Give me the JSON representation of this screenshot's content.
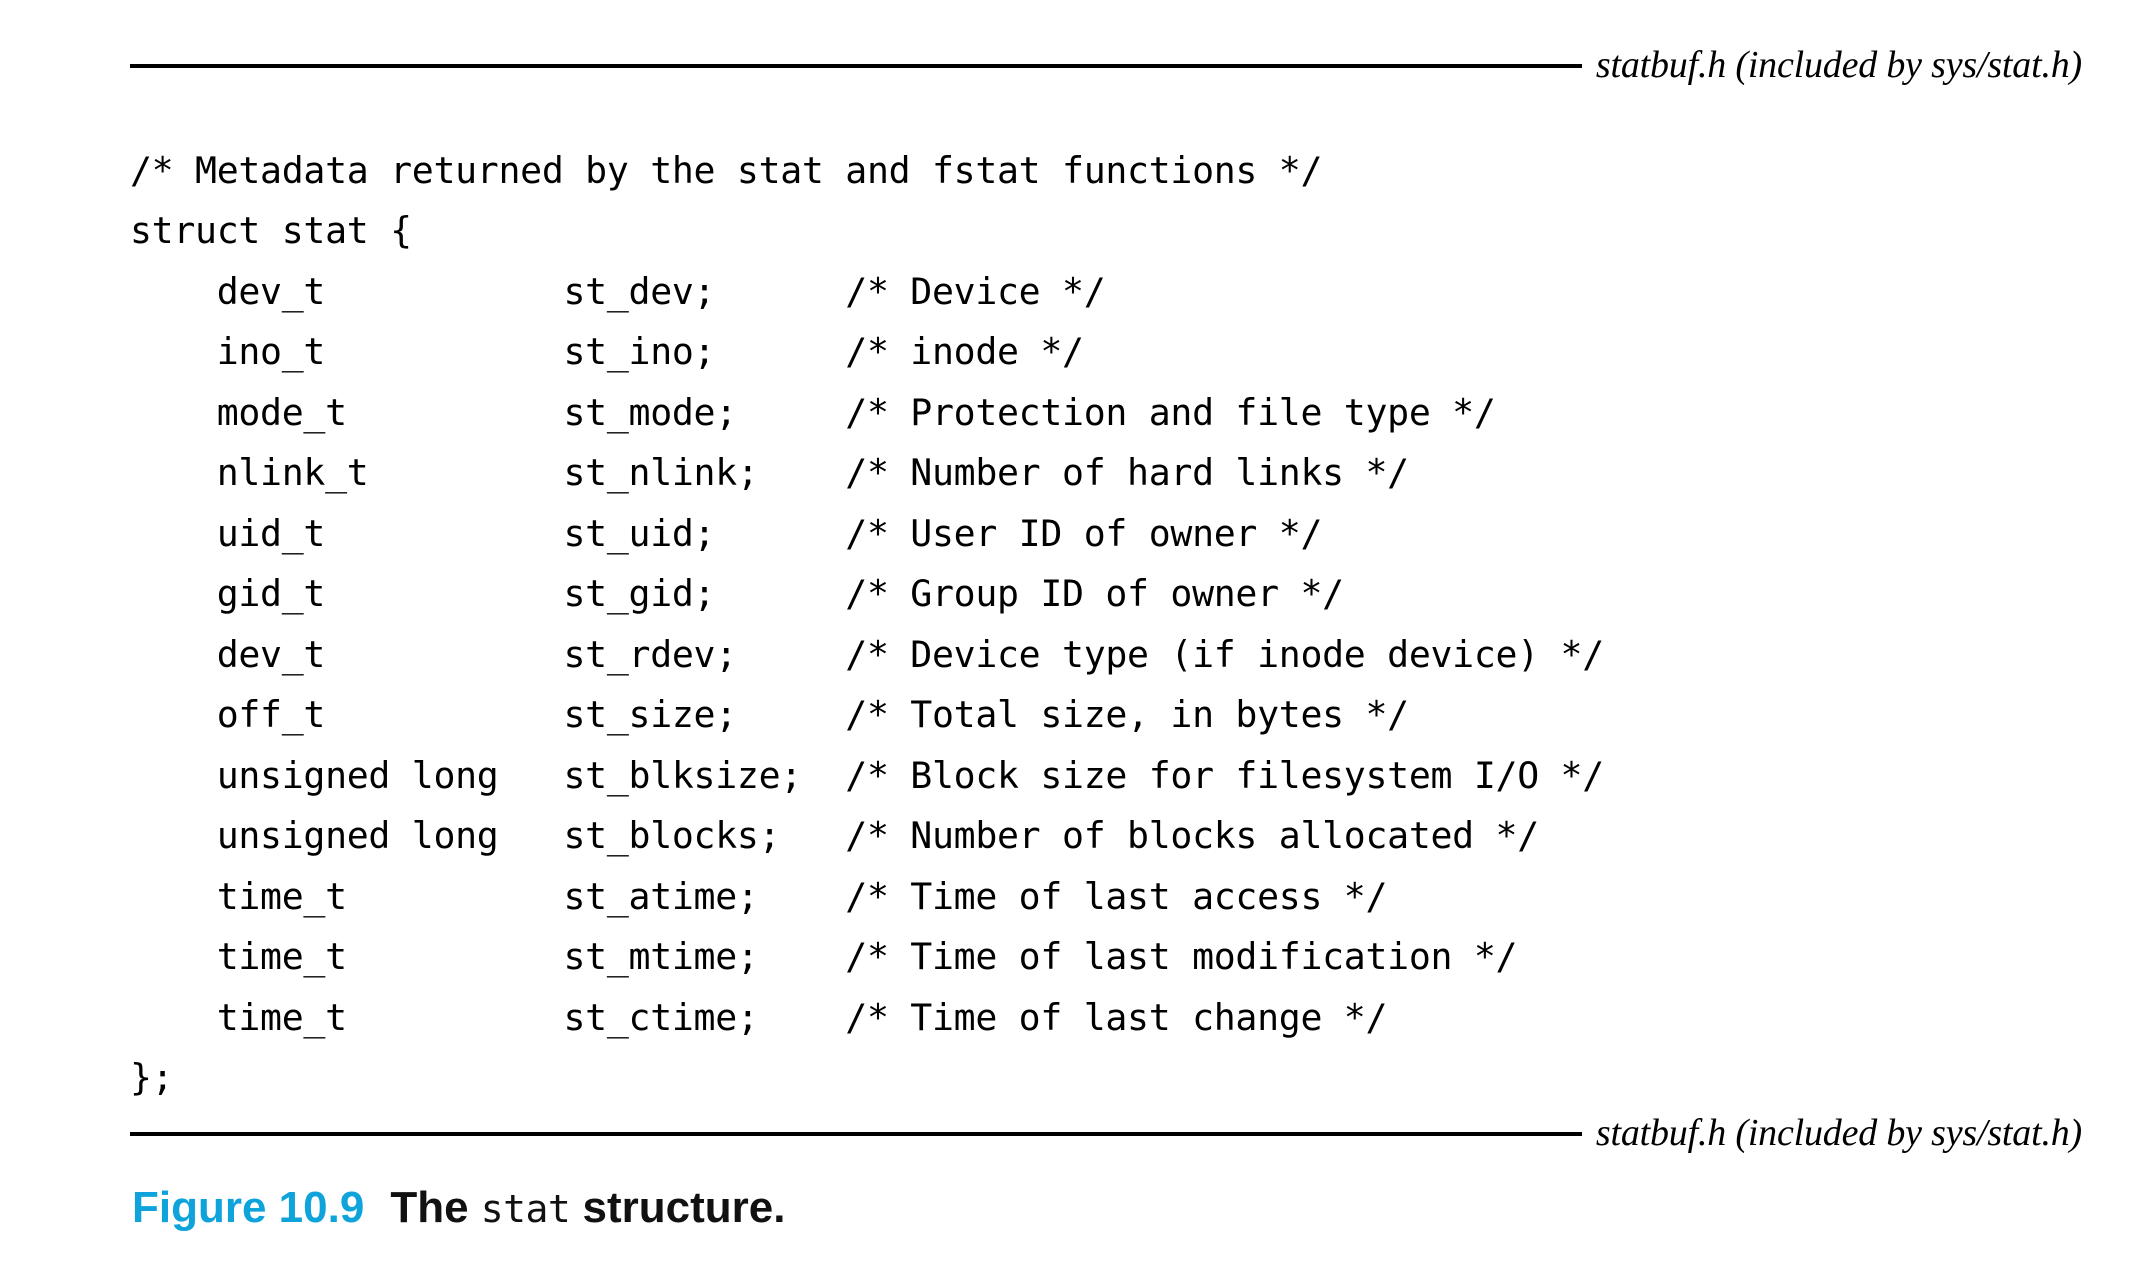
{
  "figure": {
    "header_label": "statbuf.h (included by sys/stat.h)",
    "footer_label": "statbuf.h (included by sys/stat.h)",
    "caption": {
      "number": "Figure 10.9",
      "text_before": "The ",
      "mono": "stat",
      "text_after": " structure."
    },
    "accent_color": "#0FA3DC",
    "rule_color": "#000000"
  },
  "code": {
    "lines": [
      "/* Metadata returned by the stat and fstat functions */",
      "struct stat {",
      "    dev_t           st_dev;      /* Device */",
      "    ino_t           st_ino;      /* inode */",
      "    mode_t          st_mode;     /* Protection and file type */",
      "    nlink_t         st_nlink;    /* Number of hard links */",
      "    uid_t           st_uid;      /* User ID of owner */",
      "    gid_t           st_gid;      /* Group ID of owner */",
      "    dev_t           st_rdev;     /* Device type (if inode device) */",
      "    off_t           st_size;     /* Total size, in bytes */",
      "    unsigned long   st_blksize;  /* Block size for filesystem I/O */",
      "    unsigned long   st_blocks;   /* Number of blocks allocated */",
      "    time_t          st_atime;    /* Time of last access */",
      "    time_t          st_mtime;    /* Time of last modification */",
      "    time_t          st_ctime;    /* Time of last change */",
      "};"
    ],
    "fields": [
      {
        "type": "dev_t",
        "name": "st_dev;",
        "comment": "/* Device */"
      },
      {
        "type": "ino_t",
        "name": "st_ino;",
        "comment": "/* inode */"
      },
      {
        "type": "mode_t",
        "name": "st_mode;",
        "comment": "/* Protection and file type */"
      },
      {
        "type": "nlink_t",
        "name": "st_nlink;",
        "comment": "/* Number of hard links */"
      },
      {
        "type": "uid_t",
        "name": "st_uid;",
        "comment": "/* User ID of owner */"
      },
      {
        "type": "gid_t",
        "name": "st_gid;",
        "comment": "/* Group ID of owner */"
      },
      {
        "type": "dev_t",
        "name": "st_rdev;",
        "comment": "/* Device type (if inode device) */"
      },
      {
        "type": "off_t",
        "name": "st_size;",
        "comment": "/* Total size, in bytes */"
      },
      {
        "type": "unsigned long",
        "name": "st_blksize;",
        "comment": "/* Block size for filesystem I/O */"
      },
      {
        "type": "unsigned long",
        "name": "st_blocks;",
        "comment": "/* Number of blocks allocated */"
      },
      {
        "type": "time_t",
        "name": "st_atime;",
        "comment": "/* Time of last access */"
      },
      {
        "type": "time_t",
        "name": "st_mtime;",
        "comment": "/* Time of last modification */"
      },
      {
        "type": "time_t",
        "name": "st_ctime;",
        "comment": "/* Time of last change */"
      }
    ],
    "struct_open": "struct stat {",
    "struct_close": "};",
    "top_comment": "/* Metadata returned by the stat and fstat functions */"
  }
}
